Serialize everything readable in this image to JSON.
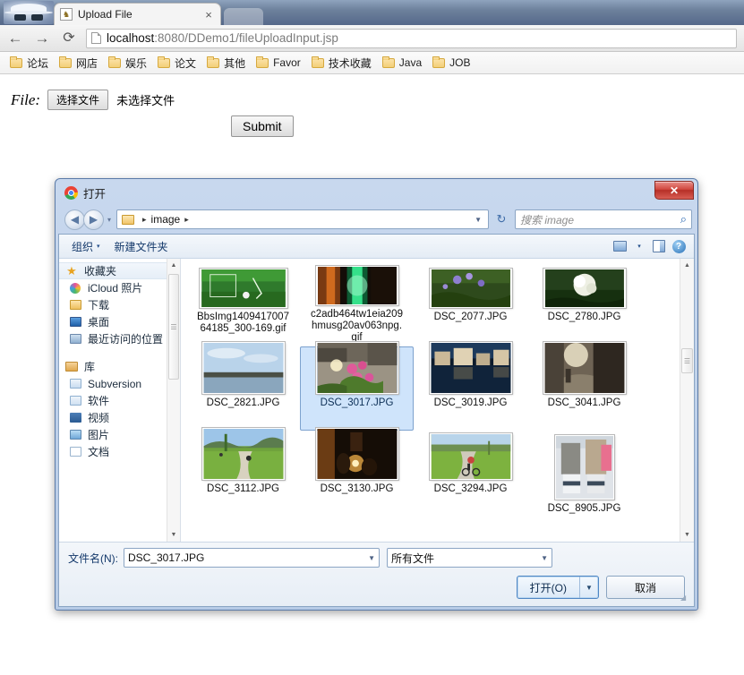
{
  "browser": {
    "incognito_icon": "incognito-spy-icon",
    "tab": {
      "title": "Upload File",
      "favicon": "♞",
      "close": "×"
    },
    "nav": {
      "back": "←",
      "forward": "→",
      "reload": "⟳"
    },
    "omnibox": {
      "host": "localhost",
      "rest": ":8080/DDemo1/fileUploadInput.jsp",
      "full": "localhost:8080/DDemo1/fileUploadInput.jsp"
    },
    "bookmarks": [
      {
        "label": "论坛"
      },
      {
        "label": "网店"
      },
      {
        "label": "娱乐"
      },
      {
        "label": "论文"
      },
      {
        "label": "其他"
      },
      {
        "label": "Favor"
      },
      {
        "label": "技术收藏"
      },
      {
        "label": "Java"
      },
      {
        "label": "JOB"
      }
    ]
  },
  "page": {
    "file_label": "File:",
    "choose_button": "选择文件",
    "no_file_text": "未选择文件",
    "submit_button": "Submit"
  },
  "dialog": {
    "title": "打开",
    "close_label": "✕",
    "nav": {
      "back": "◀",
      "forward": "▶",
      "recent_caret": "▾",
      "refresh": "↻",
      "crumb_root": "",
      "crumb_sep": "▸",
      "crumb_name": "image",
      "crumb_caret": "▼"
    },
    "search": {
      "placeholder": "搜索 image",
      "icon": "⌕"
    },
    "commands": {
      "organize": "组织",
      "organize_caret": "▾",
      "new_folder": "新建文件夹",
      "view_caret": "▾",
      "help": "?"
    },
    "sidebar": [
      {
        "label": "收藏夹",
        "icon": "star-icon",
        "type": "header"
      },
      {
        "label": "iCloud 照片",
        "icon": "icloud-photos-icon",
        "type": "item"
      },
      {
        "label": "下载",
        "icon": "downloads-icon",
        "type": "item"
      },
      {
        "label": "桌面",
        "icon": "desktop-icon",
        "type": "item"
      },
      {
        "label": "最近访问的位置",
        "icon": "recent-places-icon",
        "type": "item"
      },
      {
        "label": "库",
        "icon": "library-icon",
        "type": "header"
      },
      {
        "label": "Subversion",
        "icon": "folder-doc-icon",
        "type": "item"
      },
      {
        "label": "软件",
        "icon": "software-icon",
        "type": "item"
      },
      {
        "label": "视频",
        "icon": "video-icon",
        "type": "item"
      },
      {
        "label": "图片",
        "icon": "pictures-icon",
        "type": "item"
      },
      {
        "label": "文档",
        "icon": "documents-icon",
        "type": "item"
      }
    ],
    "files": [
      [
        {
          "name": "BbsImg140941700764185_300-169.gif",
          "selected": false,
          "kind": "gif"
        },
        {
          "name": "c2adb464tw1eia209hmusg20av063npg.gif",
          "selected": false,
          "kind": "gif"
        },
        {
          "name": "DSC_2077.JPG",
          "selected": false,
          "kind": "jpg"
        },
        {
          "name": "DSC_2780.JPG",
          "selected": false,
          "kind": "jpg"
        }
      ],
      [
        {
          "name": "DSC_2821.JPG",
          "selected": false,
          "kind": "jpg"
        },
        {
          "name": "DSC_3017.JPG",
          "selected": true,
          "kind": "jpg"
        },
        {
          "name": "DSC_3019.JPG",
          "selected": false,
          "kind": "jpg"
        },
        {
          "name": "DSC_3041.JPG",
          "selected": false,
          "kind": "jpg"
        }
      ],
      [
        {
          "name": "DSC_3112.JPG",
          "selected": false,
          "kind": "jpg"
        },
        {
          "name": "DSC_3130.JPG",
          "selected": false,
          "kind": "jpg"
        },
        {
          "name": "DSC_3294.JPG",
          "selected": false,
          "kind": "jpg"
        },
        {
          "name": "DSC_8905.JPG",
          "selected": false,
          "kind": "jpg"
        }
      ]
    ],
    "footer": {
      "filename_label": "文件名(N):",
      "filename_value": "DSC_3017.JPG",
      "filetype_value": "所有文件",
      "open_button": "打开(O)",
      "open_caret": "▼",
      "cancel_button": "取消"
    }
  },
  "colors": {
    "selection": "#cfe4fb",
    "selection_border": "#7da2ce",
    "dialog_frame": "#5b7ba8",
    "close_red": "#c73b31",
    "link_blue": "#14396b"
  }
}
